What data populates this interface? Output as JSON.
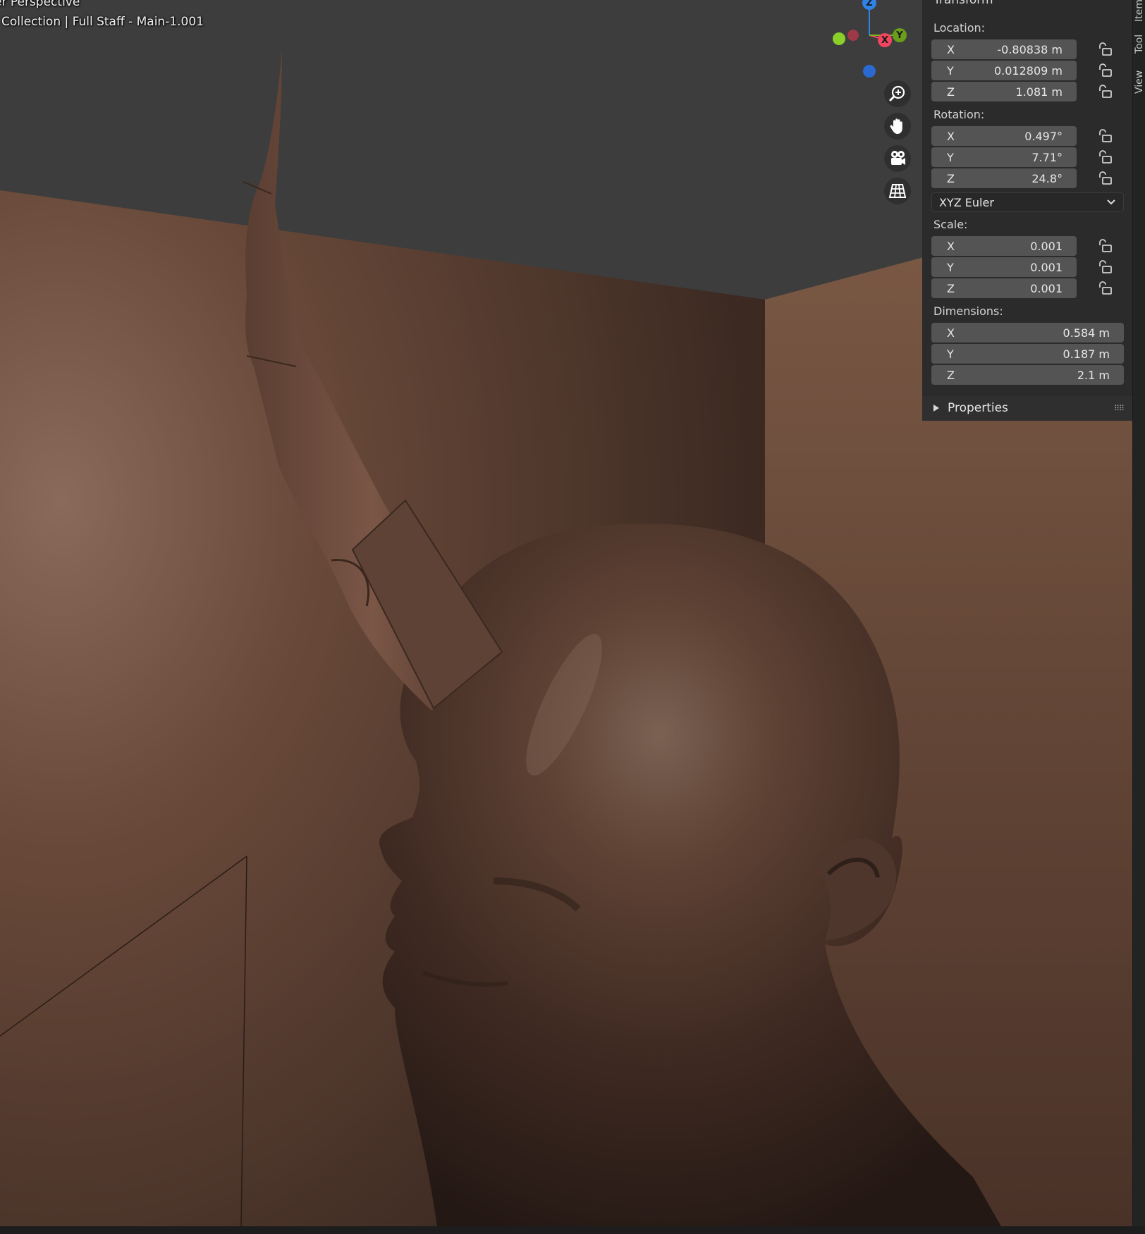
{
  "viewport": {
    "title": "er Perspective",
    "collection": "Collection | Full Staff - Main-1.001"
  },
  "gizmo": {
    "z_label": "Z",
    "x_label": "X",
    "y_label": "Y",
    "colors": {
      "x": "#f0455e",
      "y": "#7bb51a",
      "z": "#2f83e6"
    }
  },
  "nav_buttons": [
    "zoom-icon",
    "hand-pan-icon",
    "camera-icon",
    "grid-icon"
  ],
  "npanel": {
    "header": "Transform",
    "tabs": {
      "item": "Item",
      "tool": "Tool",
      "view": "View"
    },
    "location": {
      "label": "Location:",
      "x": {
        "axis": "X",
        "value": "-0.80838 m"
      },
      "y": {
        "axis": "Y",
        "value": "0.012809 m"
      },
      "z": {
        "axis": "Z",
        "value": "1.081 m"
      }
    },
    "rotation": {
      "label": "Rotation:",
      "x": {
        "axis": "X",
        "value": "0.497°"
      },
      "y": {
        "axis": "Y",
        "value": "7.71°"
      },
      "z": {
        "axis": "Z",
        "value": "24.8°"
      },
      "mode": "XYZ Euler"
    },
    "scale": {
      "label": "Scale:",
      "x": {
        "axis": "X",
        "value": "0.001"
      },
      "y": {
        "axis": "Y",
        "value": "0.001"
      },
      "z": {
        "axis": "Z",
        "value": "0.001"
      }
    },
    "dimensions": {
      "label": "Dimensions:",
      "x": {
        "axis": "X",
        "value": "0.584 m"
      },
      "y": {
        "axis": "Y",
        "value": "0.187 m"
      },
      "z": {
        "axis": "Z",
        "value": "2.1 m"
      }
    },
    "properties": {
      "label": "Properties"
    }
  }
}
